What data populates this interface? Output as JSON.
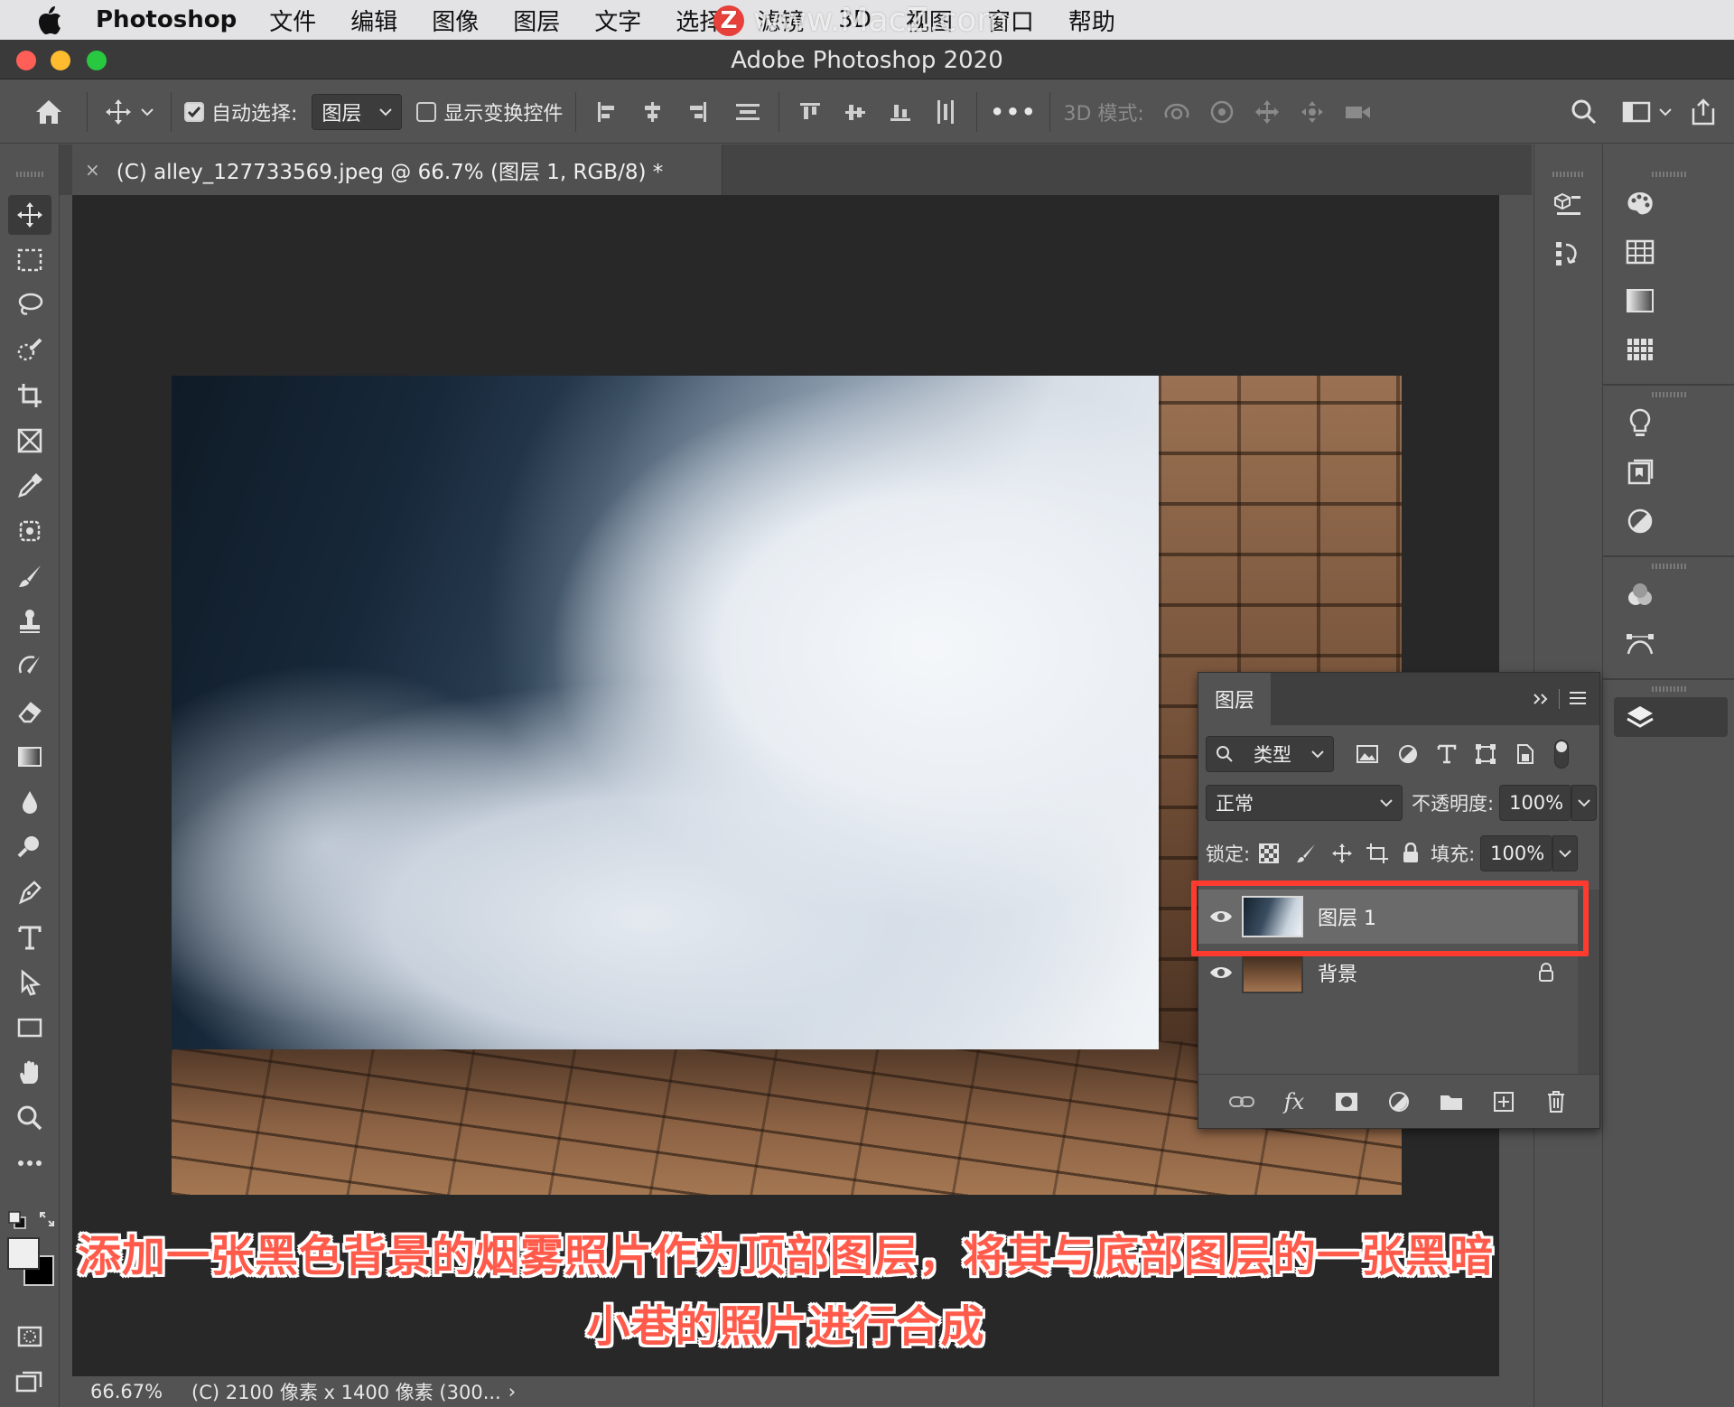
{
  "menubar": {
    "app_name": "Photoshop",
    "items": [
      "文件",
      "编辑",
      "图像",
      "图层",
      "文字",
      "选择",
      "滤镜",
      "3D",
      "视图",
      "窗口",
      "帮助"
    ]
  },
  "watermark": {
    "badge": "Z",
    "text": "www.MacZ.com"
  },
  "window": {
    "title": "Adobe Photoshop 2020"
  },
  "options": {
    "auto_select_label": "自动选择:",
    "auto_select_checked": true,
    "auto_select_value": "图层",
    "show_transform_label": "显示变换控件",
    "more_label": "•••",
    "mode_3d_label": "3D 模式:"
  },
  "document": {
    "tab_title": "(C) alley_127733569.jpeg @ 66.7% (图层 1, RGB/8) *",
    "close_glyph": "×"
  },
  "caption": {
    "line1": "添加一张黑色背景的烟雾照片作为顶部图层，将其与底部图层的一张黑暗",
    "line2": "小巷的照片进行合成"
  },
  "status": {
    "zoom": "66.67%",
    "info": "(C) 2100 像素 x 1400 像素 (300...",
    "chevron": "›"
  },
  "layers_panel": {
    "tab": "图层",
    "filter_label": "类型",
    "blend_mode": "正常",
    "opacity_label": "不透明度:",
    "opacity_value": "100%",
    "lock_label": "锁定:",
    "fill_label": "填充:",
    "fill_value": "100%",
    "layers": [
      {
        "name": "图层 1",
        "visible": true,
        "selected": true,
        "locked": false
      },
      {
        "name": "背景",
        "visible": true,
        "selected": false,
        "locked": true
      }
    ],
    "fx_label": "fx"
  },
  "colors": {
    "highlight": "#ff3b30",
    "caption": "#ff5a4a",
    "panel_bg": "#535353",
    "canvas_bg": "#282828"
  }
}
